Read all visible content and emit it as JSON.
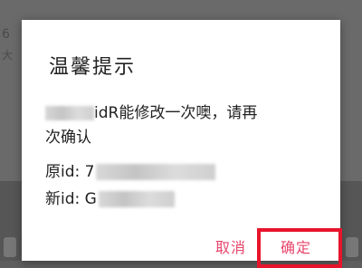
{
  "dialog": {
    "title": "温馨提示",
    "message_line1_suffix": "idR能修改一次噢，请再",
    "message_line2": "次确认",
    "orig_id_label": "原id: 7",
    "new_id_label": "新id: G",
    "cancel_label": "取消",
    "confirm_label": "确定"
  },
  "background": {
    "text_1": "6",
    "text_2": "大"
  },
  "colors": {
    "accent": "#e8456b",
    "highlight": "#e8142c",
    "overlay": "#5e5e5e"
  }
}
